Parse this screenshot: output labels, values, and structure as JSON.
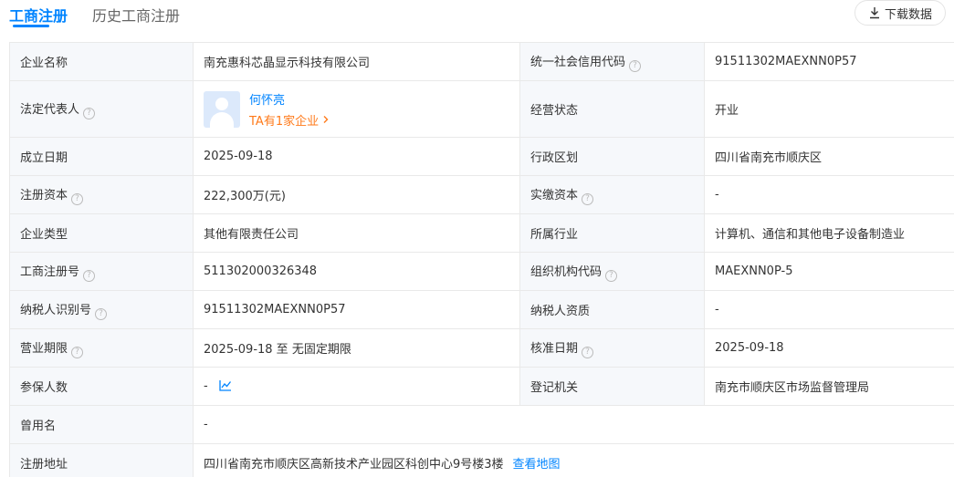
{
  "tabs": {
    "active": "工商注册",
    "history": "历史工商注册"
  },
  "toolbar": {
    "download_label": "下载数据"
  },
  "colors": {
    "accent": "#0084ff",
    "orange": "#ff7a1a",
    "label_bg": "#f6f8fb"
  },
  "rows": {
    "r1": {
      "l1": "企业名称",
      "v1": "南充惠科芯晶显示科技有限公司",
      "l2": "统一社会信用代码",
      "v2": "91511302MAEXNN0P57"
    },
    "r2": {
      "l1": "法定代表人",
      "person_name": "何怀亮",
      "person_sub": "TA有1家企业",
      "l2": "经营状态",
      "v2": "开业"
    },
    "r3": {
      "l1": "成立日期",
      "v1": "2025-09-18",
      "l2": "行政区划",
      "v2": "四川省南充市顺庆区"
    },
    "r4": {
      "l1": "注册资本",
      "v1": "222,300万(元)",
      "l2": "实缴资本",
      "v2": "-"
    },
    "r5": {
      "l1": "企业类型",
      "v1": "其他有限责任公司",
      "l2": "所属行业",
      "v2": "计算机、通信和其他电子设备制造业"
    },
    "r6": {
      "l1": "工商注册号",
      "v1": "511302000326348",
      "l2": "组织机构代码",
      "v2": "MAEXNN0P-5"
    },
    "r7": {
      "l1": "纳税人识别号",
      "v1": "91511302MAEXNN0P57",
      "l2": "纳税人资质",
      "v2": "-"
    },
    "r8": {
      "l1": "营业期限",
      "v1": "2025-09-18 至 无固定期限",
      "l2": "核准日期",
      "v2": "2025-09-18"
    },
    "r9": {
      "l1": "参保人数",
      "v1": "-",
      "l2": "登记机关",
      "v2": "南充市顺庆区市场监督管理局"
    },
    "r10": {
      "l1": "曾用名",
      "v1": "-"
    },
    "r11": {
      "l1": "注册地址",
      "v1": "四川省南充市顺庆区高新技术产业园区科创中心9号楼3楼",
      "link": "查看地图"
    }
  },
  "icons": {
    "help": "?",
    "download": "download-icon",
    "trend": "trend-chart-icon",
    "chevron": "chevron-right-icon",
    "avatar": "avatar-placeholder"
  }
}
